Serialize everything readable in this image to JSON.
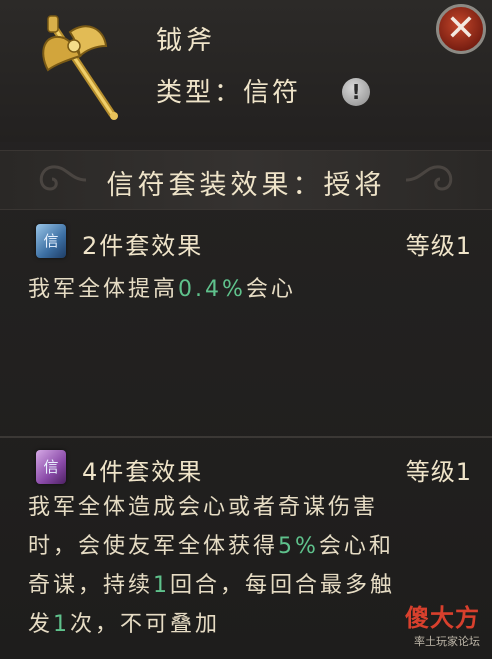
{
  "item": {
    "name": "钺斧",
    "type_label": "类型：信符",
    "icon": "golden-axe-icon"
  },
  "controls": {
    "info_symbol": "!",
    "close_symbol": "✕"
  },
  "banner": {
    "title": "信符套装效果：授将"
  },
  "sets": [
    {
      "icon_glyph": "信",
      "icon_color": "blue",
      "title": "2件套效果",
      "level": "等级1",
      "desc_parts": [
        "我军全体提高",
        "0.4%",
        "会心"
      ]
    },
    {
      "icon_glyph": "信",
      "icon_color": "purple",
      "title": "4件套效果",
      "level": "等级1",
      "desc_lines": [
        [
          "我军全体造成会心或者奇谋伤害"
        ],
        [
          "时，会使友军全体获得",
          "5%",
          "会心和"
        ],
        [
          "奇谋，持续",
          "1",
          "回合，每回合最多触"
        ],
        [
          "发",
          "1",
          "次，不可叠加"
        ]
      ]
    }
  ],
  "watermark": {
    "brand": "傻大方",
    "sub": "率土玩家论坛"
  },
  "colors": {
    "highlight": "#5fc28c",
    "text": "#e6dcc4",
    "close": "#a83520"
  }
}
